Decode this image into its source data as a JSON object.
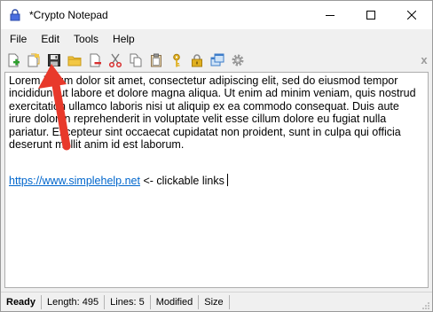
{
  "window": {
    "title": "*Crypto Notepad"
  },
  "menubar": {
    "items": [
      {
        "label": "File"
      },
      {
        "label": "Edit"
      },
      {
        "label": "Tools"
      },
      {
        "label": "Help"
      }
    ]
  },
  "toolbar": {
    "buttons": [
      {
        "icon": "new-file-icon"
      },
      {
        "icon": "open-file-icon"
      },
      {
        "icon": "save-icon"
      },
      {
        "icon": "open-folder-icon"
      },
      {
        "icon": "delete-file-icon"
      },
      {
        "icon": "cut-icon"
      },
      {
        "icon": "copy-icon"
      },
      {
        "icon": "paste-icon"
      },
      {
        "icon": "key-icon"
      },
      {
        "icon": "lock-icon"
      },
      {
        "icon": "windows-icon"
      },
      {
        "icon": "settings-icon"
      }
    ],
    "close_label": "x"
  },
  "editor": {
    "body": "Lorem ipsum dolor sit amet, consectetur adipiscing elit, sed do eiusmod tempor incididunt ut labore et dolore magna aliqua. Ut enim ad minim veniam, quis nostrud exercitation ullamco laboris nisi ut aliquip ex ea commodo consequat. Duis aute irure dolor in reprehenderit in voluptate velit esse cillum dolore eu fugiat nulla pariatur. Excepteur sint occaecat cupidatat non proident, sunt in culpa qui officia deserunt mollit anim id est laborum.",
    "link_text": "https://www.simplehelp.net",
    "link_suffix": " <- clickable links"
  },
  "statusbar": {
    "ready": "Ready",
    "length": "Length: 495",
    "lines": "Lines: 5",
    "modified": "Modified",
    "size": "Size"
  },
  "colors": {
    "link": "#0066cc",
    "annotation_arrow": "#e8392b",
    "chrome_background": "#f0f0f0"
  }
}
